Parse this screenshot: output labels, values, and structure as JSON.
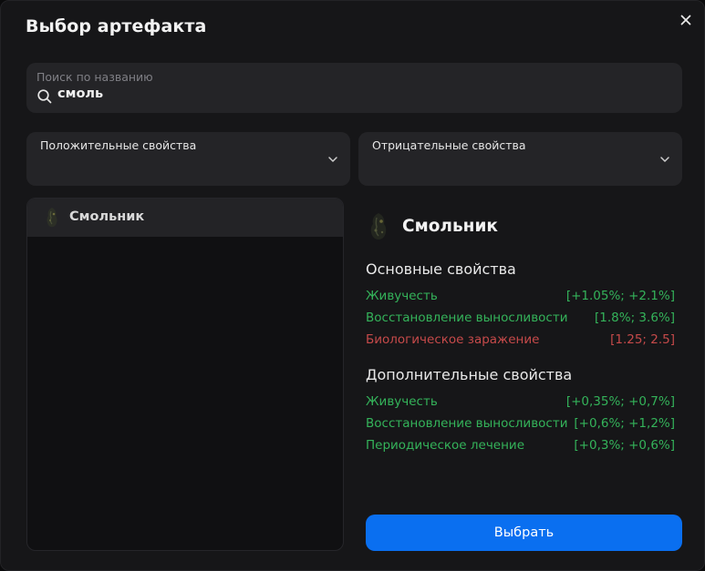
{
  "modal": {
    "title": "Выбор артефакта"
  },
  "search": {
    "placeholder": "Поиск по названию",
    "value": "смоль"
  },
  "filters": {
    "positive_label": "Положительные свойства",
    "negative_label": "Отрицательные свойства"
  },
  "list": {
    "items": [
      {
        "label": "Смольник"
      }
    ]
  },
  "detail": {
    "name": "Смольник",
    "main_title": "Основные свойства",
    "main_props": [
      {
        "name": "Живучесть",
        "value": "[+1.05%; +2.1%]",
        "type": "good"
      },
      {
        "name": "Восстановление выносливости",
        "value": "[1.8%; 3.6%]",
        "type": "good"
      },
      {
        "name": "Биологическое заражение",
        "value": "[1.25; 2.5]",
        "type": "bad"
      }
    ],
    "extra_title": "Дополнительные свойства",
    "extra_props": [
      {
        "name": "Живучесть",
        "value": "[+0,35%; +0,7%]",
        "type": "good"
      },
      {
        "name": "Восстановление выносливости",
        "value": "[+0,6%; +1,2%]",
        "type": "good"
      },
      {
        "name": "Периодическое лечение",
        "value": "[+0,3%; +0,6%]",
        "type": "good"
      }
    ]
  },
  "actions": {
    "select_label": "Выбрать"
  },
  "colors": {
    "accent": "#0a6ff0",
    "positive": "#34b35a",
    "negative": "#c64a4a",
    "panel": "#242427",
    "background": "#161618"
  },
  "icons": {
    "close": "close-icon",
    "search": "search-icon",
    "dropdown": "chevron-down-icon",
    "artifact": "artifact-icon"
  }
}
